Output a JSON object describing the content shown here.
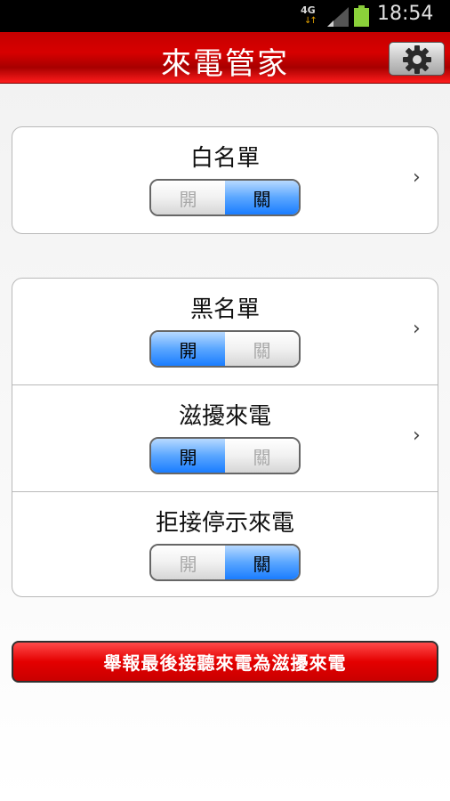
{
  "status_bar": {
    "network": "4G",
    "time": "18:54",
    "battery_color": "#8bd13a"
  },
  "header": {
    "title": "來電管家",
    "settings_icon": "gear-icon"
  },
  "toggle_labels": {
    "on": "開",
    "off": "關"
  },
  "sections": [
    {
      "rows": [
        {
          "title": "白名單",
          "state": "off",
          "has_chevron": true
        }
      ]
    },
    {
      "rows": [
        {
          "title": "黑名單",
          "state": "on",
          "has_chevron": true
        },
        {
          "title": "滋擾來電",
          "state": "on",
          "has_chevron": true
        },
        {
          "title": "拒接停示來電",
          "state": "off",
          "has_chevron": false
        }
      ]
    }
  ],
  "report_button": {
    "label": "舉報最後接聽來電為滋擾來電"
  },
  "colors": {
    "header_red": "#d70000",
    "toggle_blue": "#1a7dff",
    "button_red": "#e40000"
  }
}
